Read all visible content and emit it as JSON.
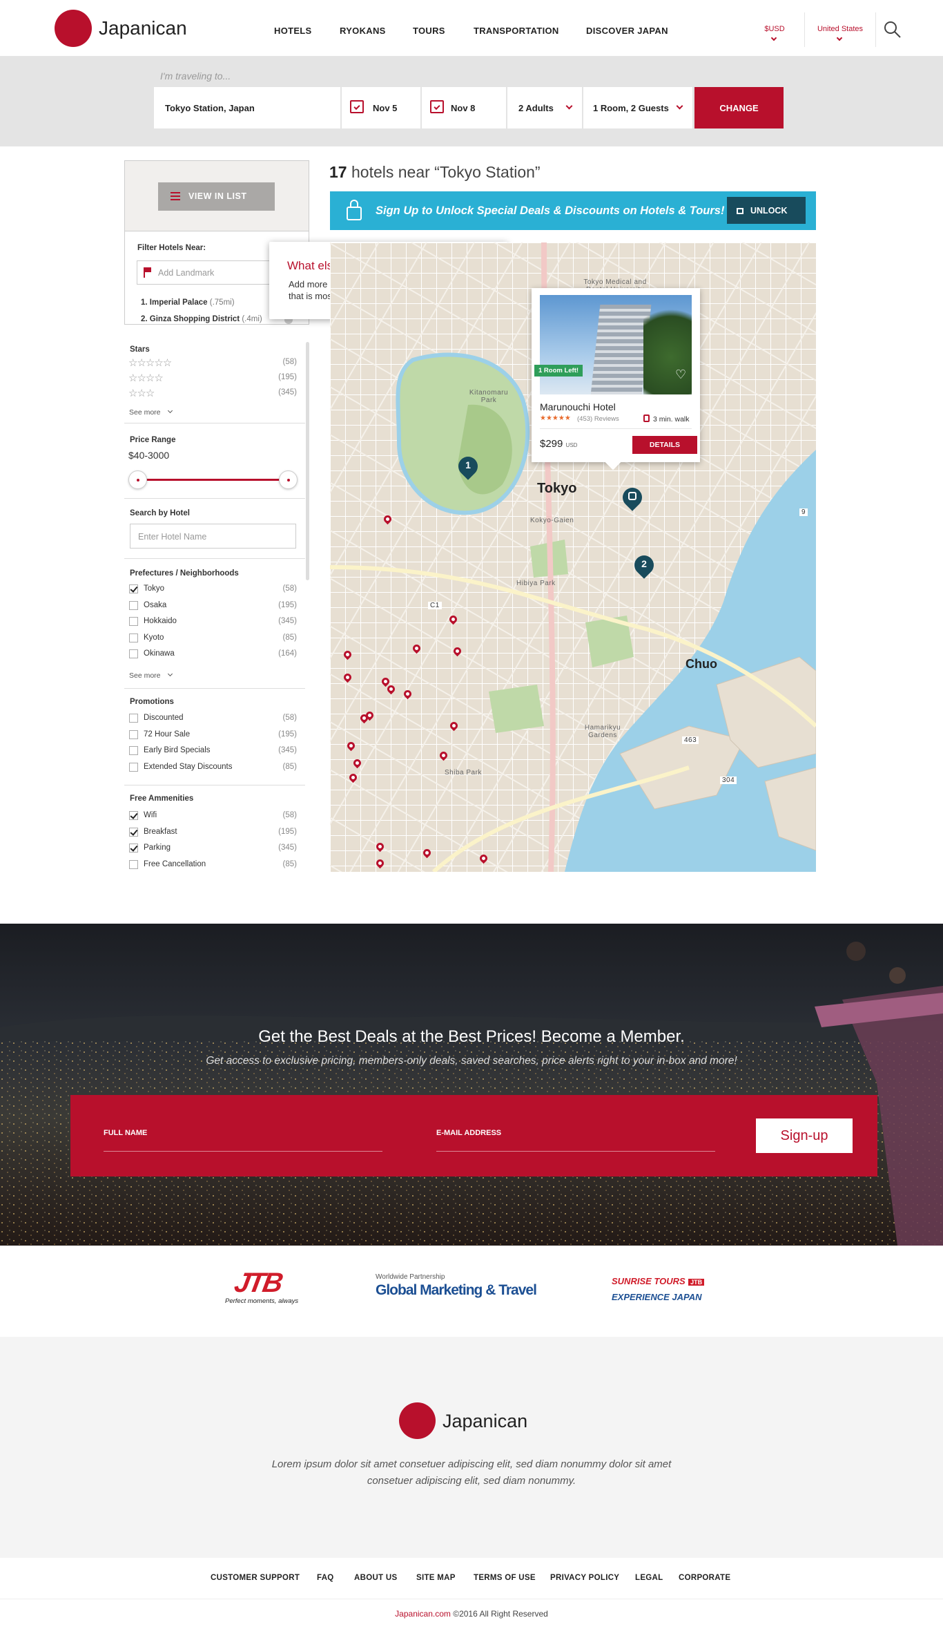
{
  "header": {
    "brand": "Japanican",
    "nav": [
      "HOTELS",
      "RYOKANS",
      "TOURS",
      "TRANSPORTATION",
      "DISCOVER JAPAN"
    ],
    "currency": "$USD",
    "country": "United States"
  },
  "search": {
    "label": "I'm traveling to...",
    "destination": "Tokyo Station, Japan",
    "checkin": "Nov 5",
    "checkout": "Nov 8",
    "guests": "2 Adults",
    "rooms": "1 Room, 2 Guests",
    "button": "CHANGE"
  },
  "sidebar": {
    "view_button": "VIEW IN LIST",
    "filter_title": "Filter Hotels Near:",
    "landmark_placeholder": "Add Landmark",
    "landmarks": [
      {
        "num": "1.",
        "name": "Imperial Palace",
        "dist": "(.75mi)"
      },
      {
        "num": "2.",
        "name": "Ginza Shopping District",
        "dist": "(.4mi)"
      }
    ],
    "stars_title": "Stars",
    "stars": [
      {
        "glyphs": "☆☆☆☆☆",
        "count": "(58)"
      },
      {
        "glyphs": "☆☆☆☆",
        "count": "(195)"
      },
      {
        "glyphs": "☆☆☆",
        "count": "(345)"
      }
    ],
    "see_more": "See more",
    "price_title": "Price Range",
    "price_value": "$40-3000",
    "search_hotel_title": "Search by Hotel",
    "search_hotel_placeholder": "Enter Hotel Name",
    "pref_title": "Prefectures / Neighborhoods",
    "prefs": [
      {
        "label": "Tokyo",
        "count": "(58)",
        "checked": true
      },
      {
        "label": "Osaka",
        "count": "(195)",
        "checked": false
      },
      {
        "label": "Hokkaido",
        "count": "(345)",
        "checked": false
      },
      {
        "label": "Kyoto",
        "count": "(85)",
        "checked": false
      },
      {
        "label": "Okinawa",
        "count": "(164)",
        "checked": false
      }
    ],
    "promo_title": "Promotions",
    "promos": [
      {
        "label": "Discounted",
        "count": "(58)",
        "checked": false
      },
      {
        "label": "72 Hour Sale",
        "count": "(195)",
        "checked": false
      },
      {
        "label": "Early Bird Specials",
        "count": "(345)",
        "checked": false
      },
      {
        "label": "Extended Stay Discounts",
        "count": "(85)",
        "checked": false
      }
    ],
    "amen_title": "Free Ammenities",
    "amens": [
      {
        "label": "Wifi",
        "count": "(58)",
        "checked": true
      },
      {
        "label": "Breakfast",
        "count": "(195)",
        "checked": true
      },
      {
        "label": "Parking",
        "count": "(345)",
        "checked": true
      },
      {
        "label": "Free Cancellation",
        "count": "(85)",
        "checked": false
      }
    ]
  },
  "tooltip": {
    "title": "What else do you want to explore?",
    "body": "Add more landmarks to help you find the hotel that is most central to your spots!"
  },
  "results": {
    "count": "17",
    "text": "hotels near “Tokyo Station”"
  },
  "promo_banner": {
    "text": "Sign Up to Unlock Special Deals & Discounts on Hotels & Tours!",
    "button": "UNLOCK"
  },
  "hotel_card": {
    "badge": "1 Room Left!",
    "name": "Marunouchi Hotel",
    "stars": "★★★★★",
    "reviews": "(453) Reviews",
    "walk": "3 min. walk",
    "price": "$299",
    "currency": "USD",
    "button": "DETAILS"
  },
  "map": {
    "labels": {
      "tokyo": "Tokyo",
      "chuo": "Chuo",
      "kitanomaru": "Kitanomaru Park",
      "hamarikyu": "Hamarikyu Gardens",
      "shiba": "Shiba Park",
      "hibiya": "Hibiya Park",
      "kokyo": "Kokyo-Gaien",
      "medical": "Tokyo Medical and Dental University"
    },
    "markers": [
      "1",
      "2"
    ],
    "road_numbers": [
      "9",
      "C1",
      "463",
      "304"
    ]
  },
  "member": {
    "title": "Get the Best Deals at the Best Prices! Become a Member.",
    "subtitle": "Get access to exclusive pricing, members-only deals, saved searches, price alerts right to your in-box and more!",
    "name_label": "FULL NAME",
    "email_label": "E-MAIL ADDRESS",
    "button": "Sign-up"
  },
  "partners": {
    "jtb": "JTB",
    "jtb_tag": "Perfect moments, always",
    "gmt_top": "Worldwide Partnership",
    "gmt": "Global Marketing & Travel",
    "sunrise": "SUNRISE TOURS",
    "sunrise_badge": "JTB",
    "experience": "EXPERIENCE JAPAN"
  },
  "footer": {
    "brand": "Japanican",
    "blurb": "Lorem ipsum dolor sit amet consetuer adipiscing elit, sed diam nonummy dolor sit amet consetuer adipiscing elit, sed diam nonummy.",
    "links": [
      "CUSTOMER SUPPORT",
      "FAQ",
      "ABOUT US",
      "SITE MAP",
      "TERMS OF USE",
      "PRIVACY POLICY",
      "LEGAL",
      "CORPORATE"
    ],
    "site": "Japanican.com",
    "copyright": "©2016 All Right Reserved"
  },
  "colors": {
    "brand": "#b8102c",
    "teal": "#2ab0d4",
    "dark_teal": "#184b5c"
  }
}
